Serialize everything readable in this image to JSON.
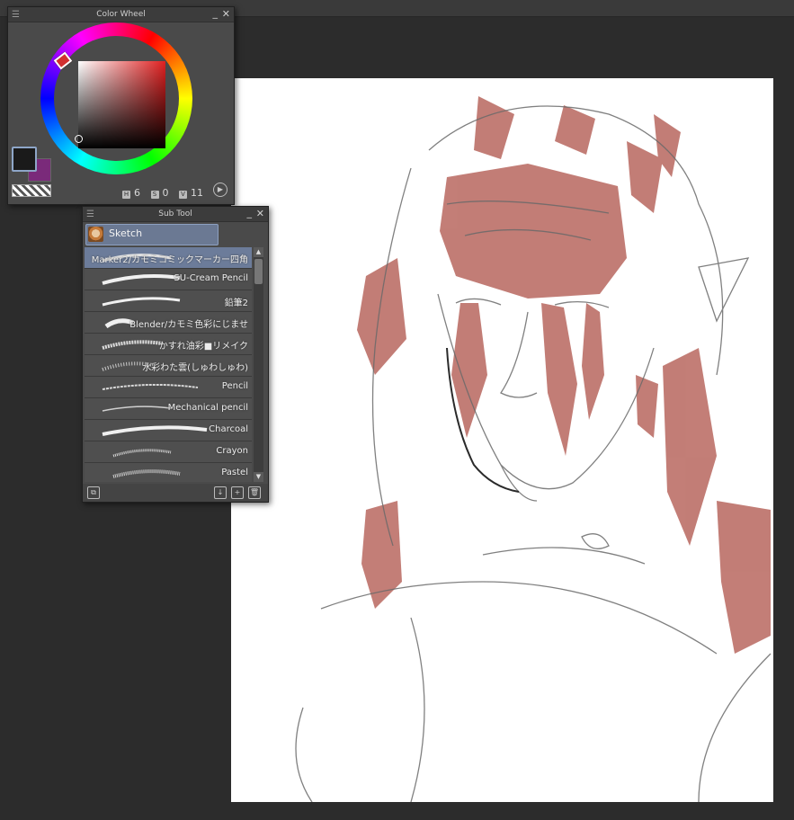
{
  "color_wheel": {
    "title": "Color Wheel",
    "values": [
      {
        "label": "H",
        "value": "6"
      },
      {
        "label": "S",
        "value": "0"
      },
      {
        "label": "V",
        "value": "11"
      }
    ],
    "main_color": "#1a1a1a",
    "sub_color": "#7a2a7a"
  },
  "sub_tool": {
    "title": "Sub Tool",
    "group": "Sketch",
    "items": [
      {
        "label": "Marker2/カモミコミックマーカー四角",
        "selected": true
      },
      {
        "label": "SU-Cream Pencil",
        "selected": false
      },
      {
        "label": "鉛筆2",
        "selected": false
      },
      {
        "label": "Blender/カモミ色彩にじませ",
        "selected": false
      },
      {
        "label": "かすれ油彩■リメイク",
        "selected": false
      },
      {
        "label": "水彩わた雲(しゅわしゅわ)",
        "selected": false
      },
      {
        "label": "Pencil",
        "selected": false
      },
      {
        "label": "Mechanical pencil",
        "selected": false
      },
      {
        "label": "Charcoal",
        "selected": false
      },
      {
        "label": "Crayon",
        "selected": false
      },
      {
        "label": "Pastel",
        "selected": false
      }
    ]
  },
  "icons": {
    "panel_menu": "menu-icon",
    "minimize": "minimize-icon",
    "close": "close-icon",
    "wheel_play": "play-circle-icon",
    "sub_tool_settings": "tool-property-icon",
    "new_sub_tool": "download-icon",
    "duplicate": "duplicate-icon",
    "delete": "trash-icon"
  }
}
